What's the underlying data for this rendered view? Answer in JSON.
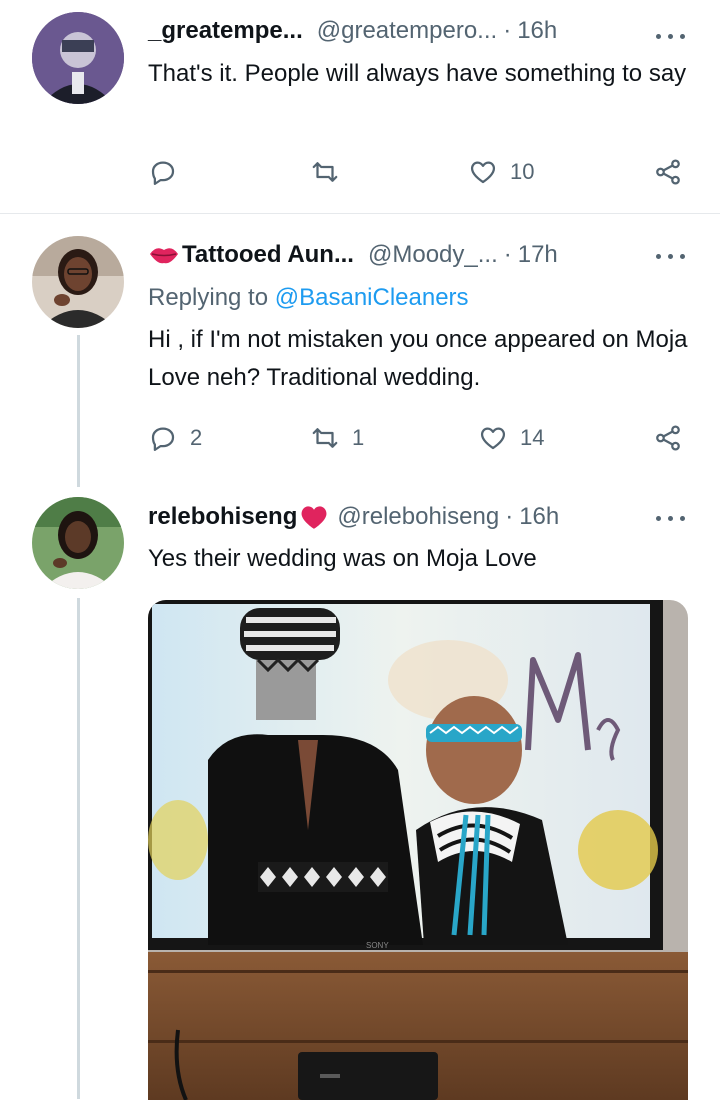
{
  "tweets": [
    {
      "name": "_greatempe...",
      "handle": "@greatempero...",
      "time": "16h",
      "text": "That's it. People will always have something to say",
      "reply_count": "",
      "retweet_count": "",
      "like_count": "10"
    },
    {
      "name": "Tattooed Aun...",
      "handle": "@Moody_...",
      "time": "17h",
      "replying_prefix": "Replying to",
      "replying_to": "@BasaniCleaners",
      "text": "Hi , if I'm not mistaken you once appeared on Moja Love neh? Traditional wedding.",
      "reply_count": "2",
      "retweet_count": "1",
      "like_count": "14"
    },
    {
      "name": "relebohiseng",
      "handle": "@relebohiseng",
      "time": "16h",
      "text": "Yes their wedding was on Moja Love",
      "tv_brand": "SONY"
    }
  ],
  "separator": "·",
  "colors": {
    "text": "#0f1419",
    "secondary": "#536471",
    "link": "#1d9bf0",
    "heart_emoji": "#e0245e"
  }
}
